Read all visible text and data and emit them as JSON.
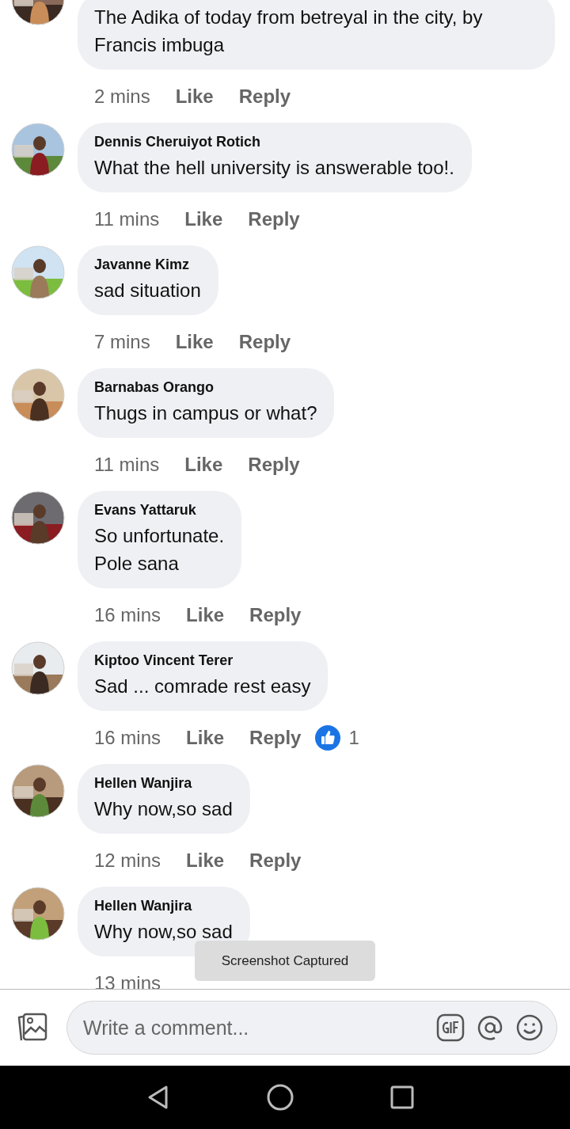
{
  "comments": [
    {
      "text": "The Adika of today from betreyal in the city, by Francis imbuga",
      "time": "2 mins",
      "like": "Like",
      "reply": "Reply"
    },
    {
      "name": "Dennis Cheruiyot Rotich",
      "text": "What the hell university is answerable too!.",
      "time": "11 mins",
      "like": "Like",
      "reply": "Reply"
    },
    {
      "name": "Javanne Kimz",
      "text": "sad situation",
      "time": "7 mins",
      "like": "Like",
      "reply": "Reply"
    },
    {
      "name": "Barnabas Orango",
      "text": "Thugs in campus or what?",
      "time": "11 mins",
      "like": "Like",
      "reply": "Reply"
    },
    {
      "name": "Evans Yattaruk",
      "text": "So unfortunate.\nPole sana",
      "time": "16 mins",
      "like": "Like",
      "reply": "Reply"
    },
    {
      "name": "Kiptoo Vincent Terer",
      "text": "Sad ... comrade rest easy",
      "time": "16 mins",
      "like": "Like",
      "reply": "Reply",
      "reaction_count": "1"
    },
    {
      "name": "Hellen Wanjira",
      "text": "Why now,so sad",
      "time": "12 mins",
      "like": "Like",
      "reply": "Reply"
    },
    {
      "name": "Hellen Wanjira",
      "text": "Why now,so sad",
      "time": "13 mins"
    }
  ],
  "toast": "Screenshot Captured",
  "composer": {
    "placeholder": "Write a comment..."
  }
}
